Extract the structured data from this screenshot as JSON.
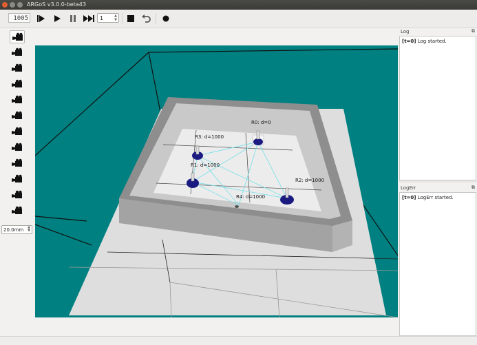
{
  "window": {
    "title": "ARGoS v3.0.0-beta43"
  },
  "toolbar": {
    "step_counter": "1005",
    "step_spin_value": "1",
    "buttons": [
      {
        "name": "step-button",
        "icon": "step-icon"
      },
      {
        "name": "play-button",
        "icon": "play-icon"
      },
      {
        "name": "pause-button",
        "icon": "pause-icon"
      },
      {
        "name": "fast-forward-button",
        "icon": "fast-forward-icon"
      },
      {
        "name": "stop-button",
        "icon": "stop-icon"
      },
      {
        "name": "reset-button",
        "icon": "undo-icon"
      },
      {
        "name": "record-button",
        "icon": "record-icon"
      }
    ]
  },
  "cameras": {
    "count": 12,
    "active_index": 0,
    "icon": "camera-icon"
  },
  "zoom": {
    "value": "20.0mm"
  },
  "scene": {
    "robots": [
      {
        "id": "R0",
        "label": "R0: d=0"
      },
      {
        "id": "R1",
        "label": "R1: d=1000"
      },
      {
        "id": "R2",
        "label": "R2: d=1000"
      },
      {
        "id": "R3",
        "label": "R3: d=1000"
      },
      {
        "id": "R4",
        "label": "R4: d=1000"
      }
    ],
    "colors": {
      "background": "#008080",
      "floor": "#dcdcdc",
      "wall": "#8c8c8c",
      "robot": "#1a1a80",
      "link": "#7fe0e8"
    }
  },
  "log": {
    "title": "Log",
    "entry_tag": "[t=0]",
    "entry_text": " Log started."
  },
  "logerr": {
    "title": "LogErr",
    "entry_tag": "[t=0]",
    "entry_text": " LogErr started."
  }
}
